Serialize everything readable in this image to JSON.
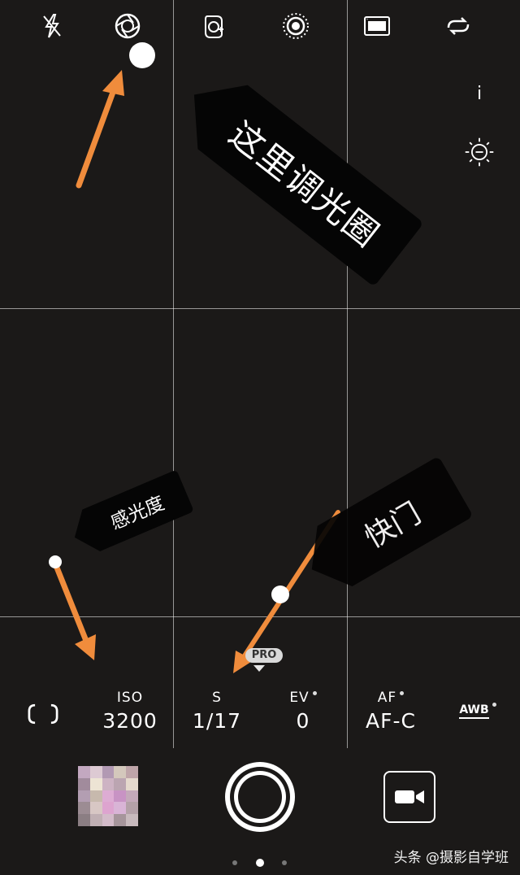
{
  "top_bar": {
    "icons": [
      "flash-off-icon",
      "aperture-icon",
      "beauty-icon",
      "live-photo-icon",
      "filmstrip-icon",
      "loop-icon"
    ]
  },
  "side": {
    "info_label": "i",
    "exposure_icon": "brightness-minus-icon"
  },
  "annotations": {
    "aperture_callout": "这里调光圈",
    "iso_callout": "感光度",
    "shutter_callout": "快门",
    "color": "#f08c3c"
  },
  "pro_badge": "PRO",
  "settings": [
    {
      "label": "ISO",
      "value": "3200",
      "dot": false
    },
    {
      "label": "S",
      "value": "1/17",
      "dot": false
    },
    {
      "label": "EV",
      "value": "0",
      "dot": true
    },
    {
      "label": "AF",
      "value": "AF-C",
      "dot": true
    }
  ],
  "metering_icon": "metering-icon",
  "awb_label": "AWB",
  "controls": {
    "thumbnail_icon": "gallery-thumbnail",
    "shutter_icon": "shutter-button-icon",
    "video_icon": "video-camera-icon"
  },
  "watermark": "头条 @摄影自学班"
}
